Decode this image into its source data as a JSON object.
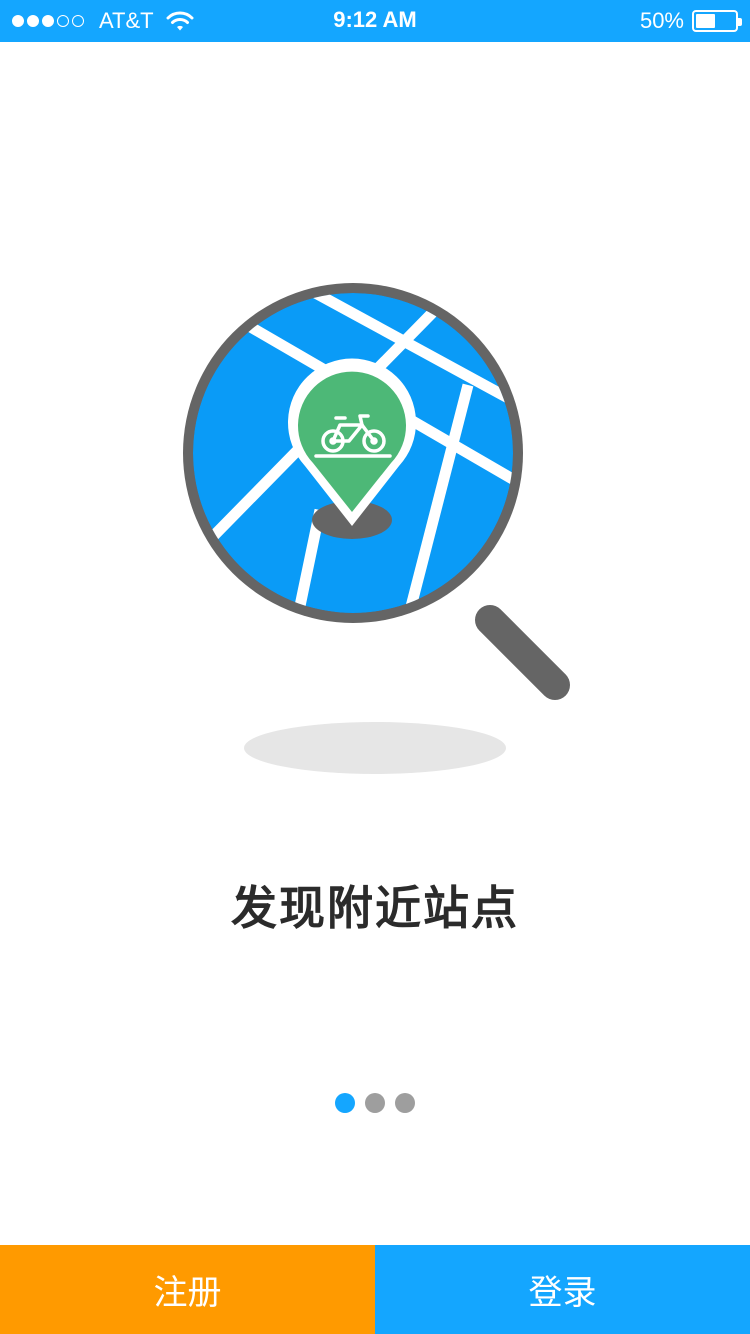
{
  "status_bar": {
    "carrier": "AT&T",
    "time": "9:12 AM",
    "battery": "50%",
    "battery_level": 0.5,
    "signal_bars_filled": 3,
    "signal_bars_total": 5,
    "wifi_icon": "wifi-icon",
    "background_color": "#14a6ff"
  },
  "illustration": {
    "icons": [
      "magnifier-icon",
      "map-icon",
      "location-pin-icon",
      "bicycle-icon"
    ],
    "map_color": "#0a9bf7",
    "pin_color": "#4db877",
    "magnifier_color": "#656565"
  },
  "title": "发现附近站点",
  "pagination": {
    "total": 3,
    "active": 0,
    "active_color": "#14a6ff",
    "inactive_color": "#9e9e9e"
  },
  "buttons": {
    "register": {
      "label": "注册",
      "color": "#ff9a00"
    },
    "login": {
      "label": "登录",
      "color": "#14a6ff"
    }
  }
}
